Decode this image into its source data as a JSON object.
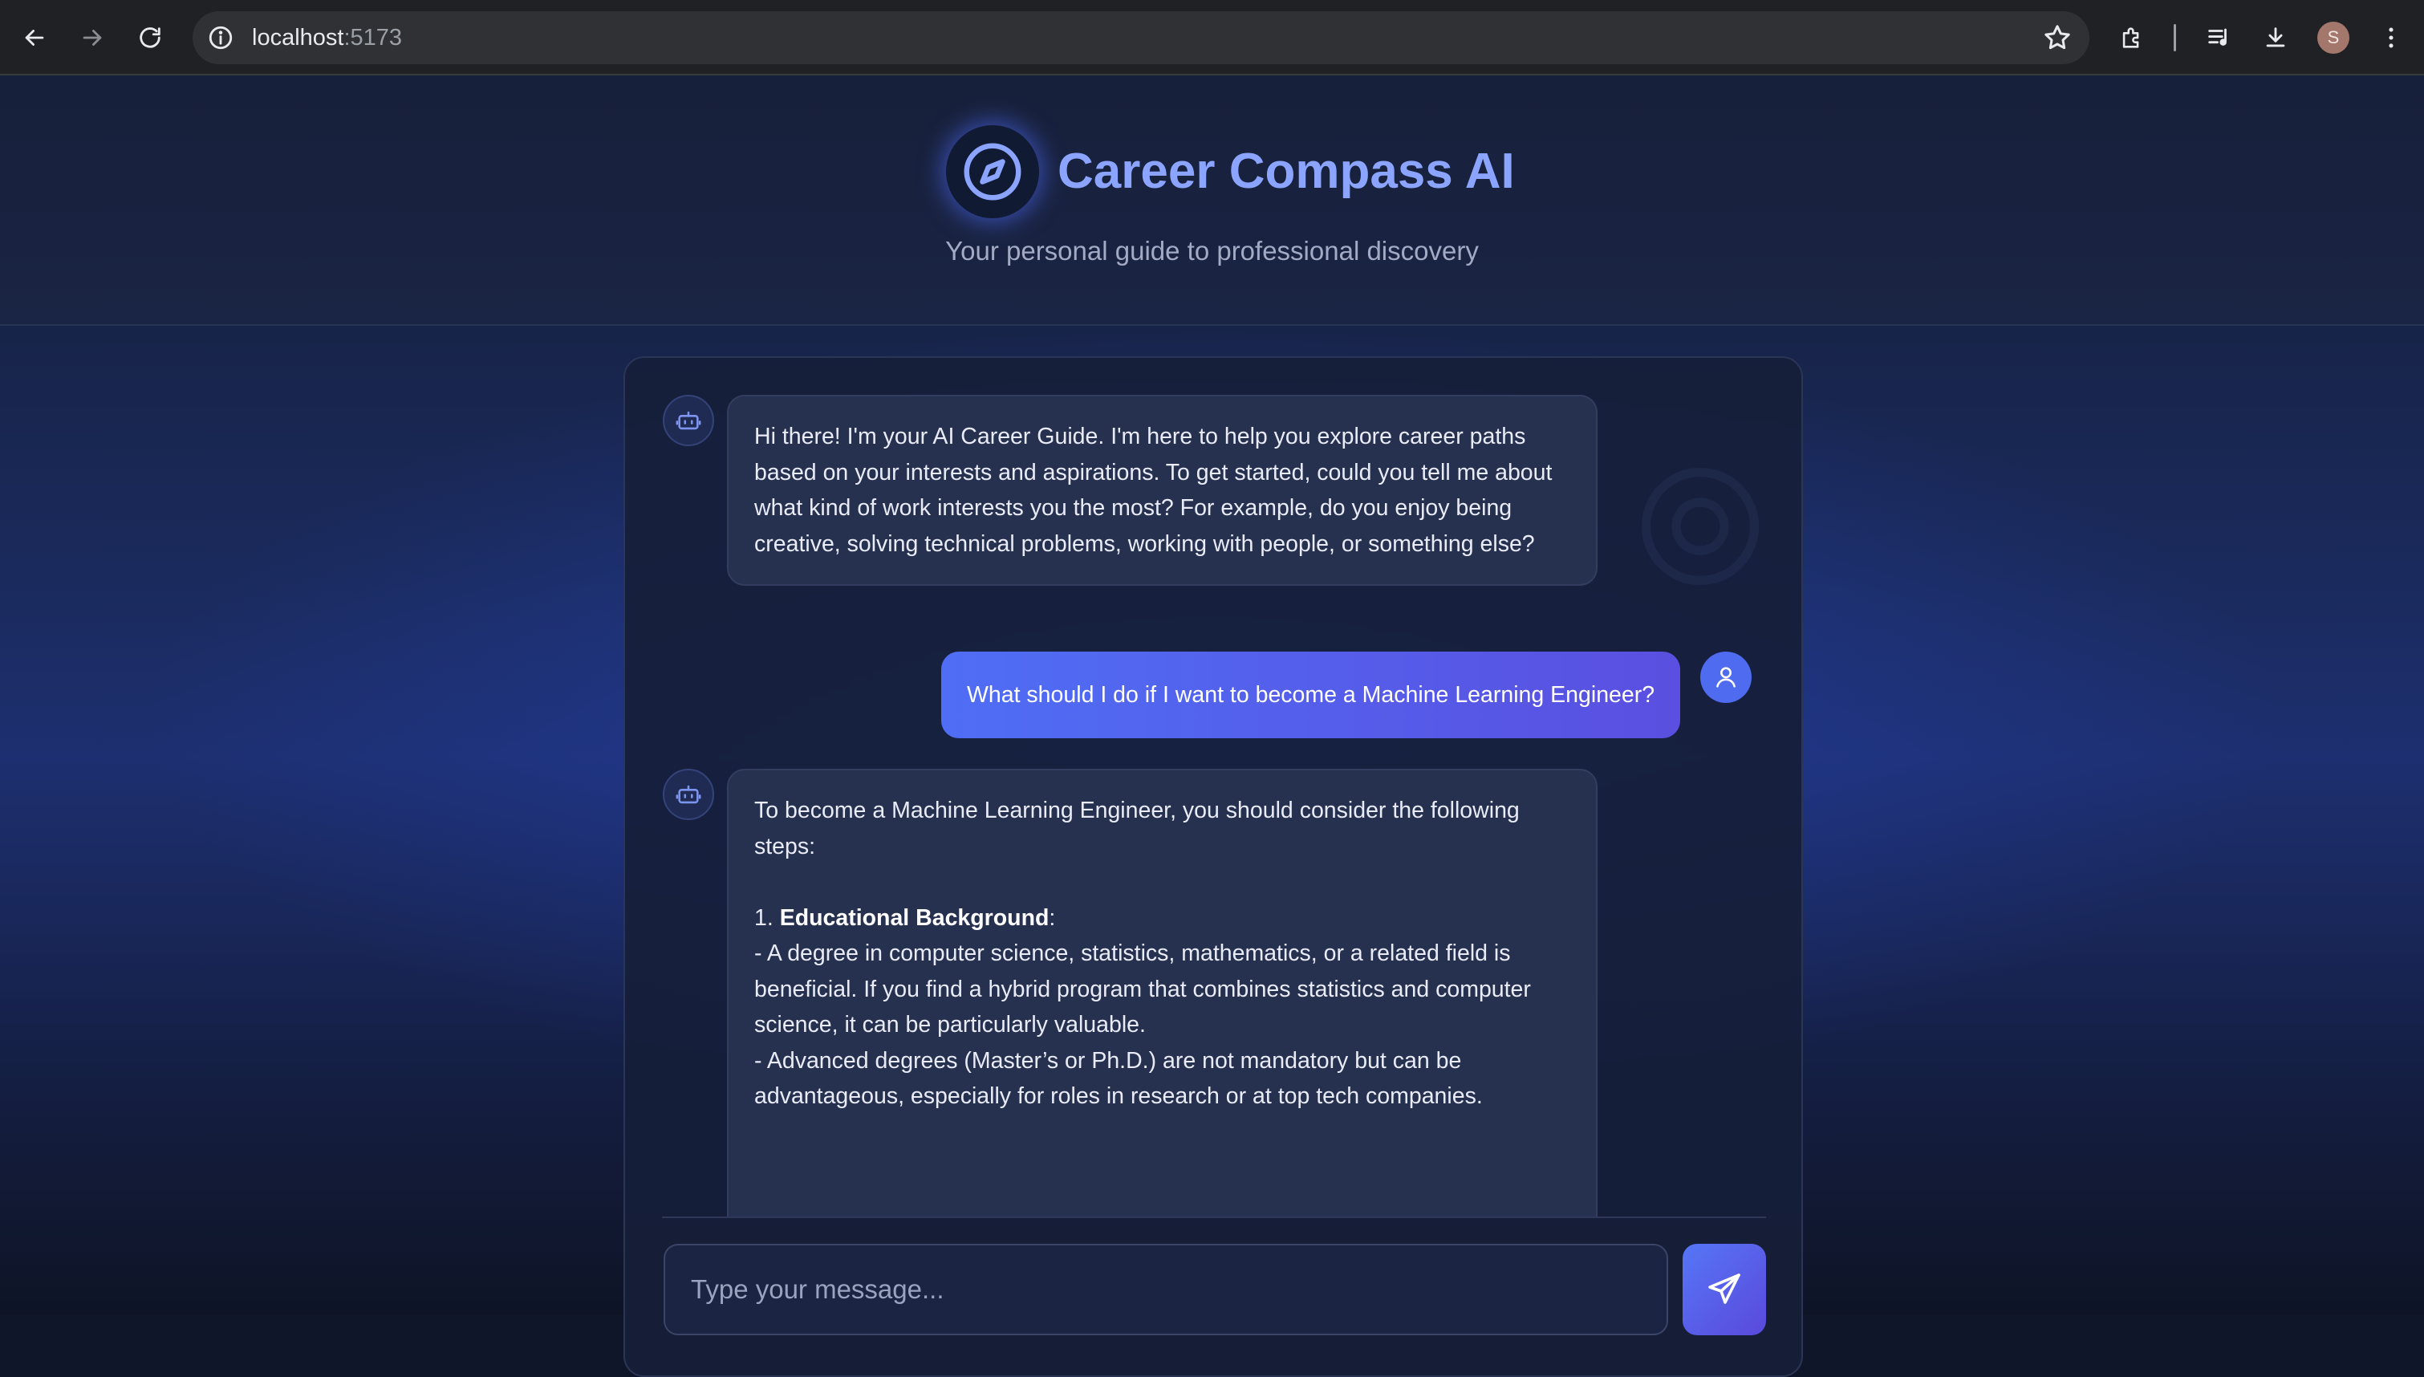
{
  "browser": {
    "url_host": "localhost",
    "url_port": ":5173"
  },
  "app": {
    "title": "Career Compass AI",
    "subtitle": "Your personal guide to professional discovery"
  },
  "chat": {
    "message_1": "Hi there! I'm your AI Career Guide. I'm here to help you explore career paths based on your interests and aspirations. To get started, could you tell me about what kind of work interests you the most? For example, do you enjoy being creative, solving technical problems, working with people, or something else?",
    "message_2": "What should I do if I want to become a Machine Learning Engineer?",
    "message_3": {
      "intro": "To become a Machine Learning Engineer, you should consider the following steps:",
      "step_number": "1.",
      "step_title": "Educational Background",
      "step_colon": ":",
      "bullet_1": "- A degree in computer science, statistics, mathematics, or a related field is beneficial. If you find a hybrid program that combines statistics and computer science, it can be particularly valuable.",
      "bullet_2": "- Advanced degrees (Master’s or Ph.D.) are not mandatory but can be advantageous, especially for roles in research or at top tech companies."
    }
  },
  "input": {
    "placeholder": "Type your message..."
  },
  "profile": {
    "initial": "S"
  }
}
